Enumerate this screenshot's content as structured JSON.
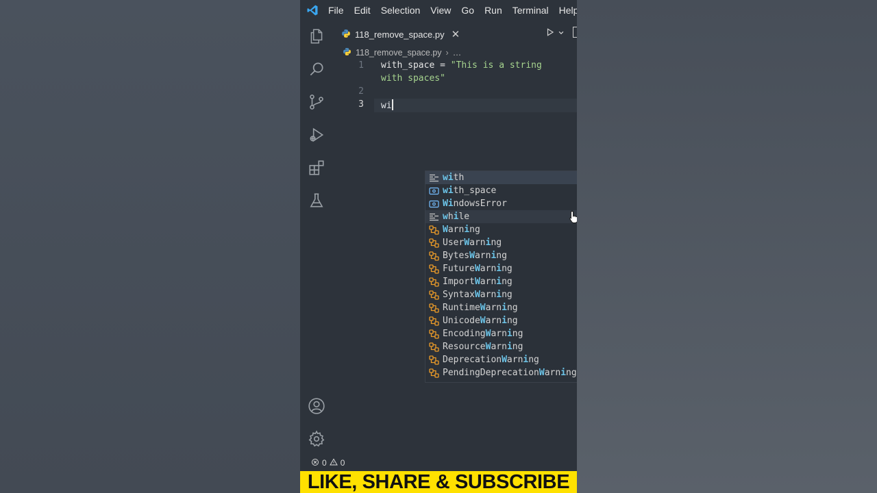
{
  "menu": [
    "File",
    "Edit",
    "Selection",
    "View",
    "Go",
    "Run",
    "Terminal",
    "Help"
  ],
  "tab": {
    "filename": "118_remove_space.py",
    "close_glyph": "✕"
  },
  "breadcrumb": {
    "file": "118_remove_space.py",
    "ellipsis": "…"
  },
  "editor": {
    "lines": [
      {
        "num": "1",
        "text_a": "with_space = ",
        "text_b": "\"This is a string",
        "text_c": "with spaces\""
      },
      {
        "num": "2",
        "text": ""
      },
      {
        "num": "3",
        "text": "wi"
      }
    ]
  },
  "suggestions": [
    {
      "kind": "keyword",
      "pre": "",
      "match": "wi",
      "post": "th"
    },
    {
      "kind": "variable",
      "pre": "",
      "match": "wi",
      "post": "th_space"
    },
    {
      "kind": "variable",
      "pre": "",
      "match": "Wi",
      "post": "ndowsError"
    },
    {
      "kind": "keyword",
      "pre": "",
      "match": "w",
      "mid": "h",
      "match2": "i",
      "post": "le"
    },
    {
      "kind": "class",
      "pre": "",
      "match": "W",
      "mid": "arn",
      "match2": "i",
      "post": "ng"
    },
    {
      "kind": "class",
      "pre": "User",
      "match": "W",
      "mid": "arn",
      "match2": "i",
      "post": "ng"
    },
    {
      "kind": "class",
      "pre": "Bytes",
      "match": "W",
      "mid": "arn",
      "match2": "i",
      "post": "ng"
    },
    {
      "kind": "class",
      "pre": "Future",
      "match": "W",
      "mid": "arn",
      "match2": "i",
      "post": "ng"
    },
    {
      "kind": "class",
      "pre": "Import",
      "match": "W",
      "mid": "arn",
      "match2": "i",
      "post": "ng"
    },
    {
      "kind": "class",
      "pre": "Syntax",
      "match": "W",
      "mid": "arn",
      "match2": "i",
      "post": "ng"
    },
    {
      "kind": "class",
      "pre": "Runtime",
      "match": "W",
      "mid": "arn",
      "match2": "i",
      "post": "ng"
    },
    {
      "kind": "class",
      "pre": "Unicode",
      "match": "W",
      "mid": "arn",
      "match2": "i",
      "post": "ng"
    },
    {
      "kind": "class",
      "pre": "Encoding",
      "match": "W",
      "mid": "arn",
      "match2": "i",
      "post": "ng"
    },
    {
      "kind": "class",
      "pre": "Resource",
      "match": "W",
      "mid": "arn",
      "match2": "i",
      "post": "ng"
    },
    {
      "kind": "class",
      "pre": "Deprecation",
      "match": "W",
      "mid": "arn",
      "match2": "i",
      "post": "ng"
    },
    {
      "kind": "class",
      "pre": "PendingDeprecation",
      "match": "W",
      "mid": "arn",
      "match2": "i",
      "post": "ng"
    }
  ],
  "status": {
    "errors": "0",
    "warnings": "0"
  },
  "banner": {
    "text": "LIKE, SHARE & SUBSCRIBE"
  },
  "colors": {
    "accent_vscode": "#3aa6f0",
    "match_highlight": "#6cc4e8",
    "class_icon": "#e8a03c",
    "banner_bg": "#ffe100"
  }
}
